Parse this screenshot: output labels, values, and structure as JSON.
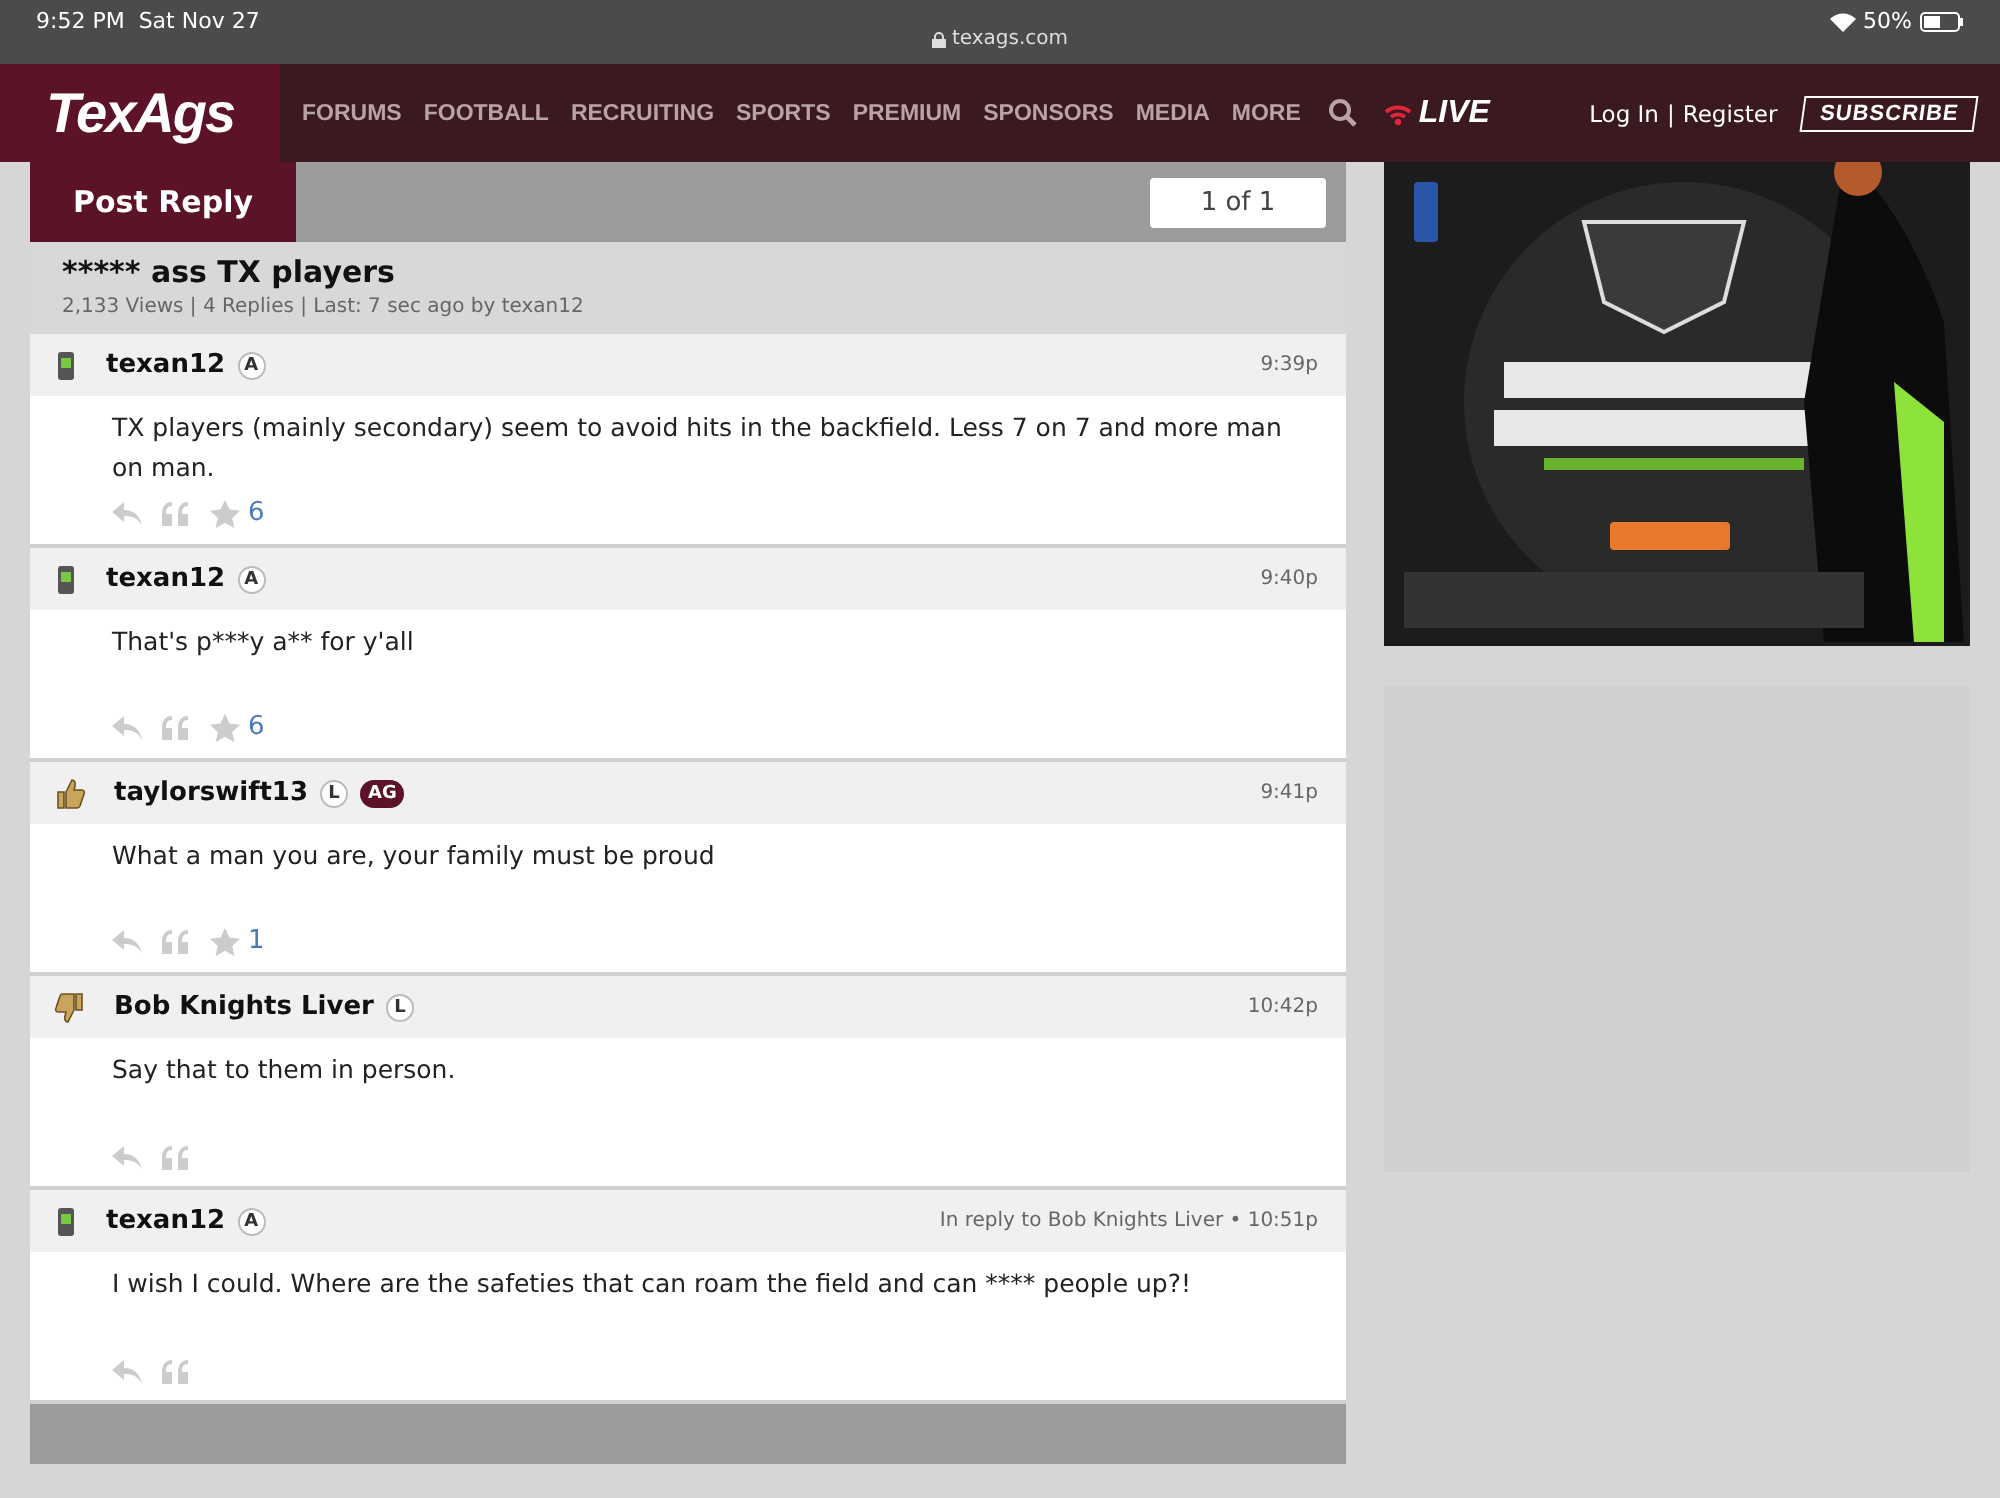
{
  "status_bar": {
    "time": "9:52 PM",
    "date": "Sat Nov 27",
    "url": "texags.com",
    "battery": "50%"
  },
  "nav": {
    "logo": "TexAgs",
    "items": [
      "FORUMS",
      "FOOTBALL",
      "RECRUITING",
      "SPORTS",
      "PREMIUM",
      "SPONSORS",
      "MEDIA",
      "MORE"
    ],
    "live": "LIVE",
    "login": "Log In",
    "separator": "|",
    "register": "Register",
    "subscribe": "SUBSCRIBE"
  },
  "toolbar": {
    "post_reply": "Post Reply",
    "page": "1 of 1"
  },
  "thread": {
    "title": "***** ass TX players",
    "meta": "2,133 Views | 4 Replies | Last: 7 sec ago by texan12"
  },
  "posts": [
    {
      "author": "texan12",
      "kind": "phone",
      "badges": [
        {
          "label": "A",
          "kind": "circle"
        }
      ],
      "time": "9:39p",
      "body": "TX players (mainly secondary) seem to avoid hits in the backfield. Less 7 on 7 and more man on man.",
      "stars": "6"
    },
    {
      "author": "texan12",
      "kind": "phone",
      "badges": [
        {
          "label": "A",
          "kind": "circle"
        }
      ],
      "time": "9:40p",
      "body": "That's p***y a** for y'all",
      "stars": "6"
    },
    {
      "author": "taylorswift13",
      "kind": "thumbs-up",
      "badges": [
        {
          "label": "L",
          "kind": "circle"
        },
        {
          "label": "AG",
          "kind": "pill"
        }
      ],
      "time": "9:41p",
      "body": "What a man you are, your family must be proud",
      "stars": "1"
    },
    {
      "author": "Bob Knights Liver",
      "kind": "thumbs-down",
      "badges": [
        {
          "label": "L",
          "kind": "circle"
        }
      ],
      "time": "10:42p",
      "body": "Say that to them in person."
    },
    {
      "author": "texan12",
      "kind": "phone",
      "badges": [
        {
          "label": "A",
          "kind": "circle"
        }
      ],
      "time": "In reply to Bob Knights Liver • 10:51p",
      "body": "I wish I could. Where are the safeties that can roam the field and can **** people up?!"
    }
  ]
}
